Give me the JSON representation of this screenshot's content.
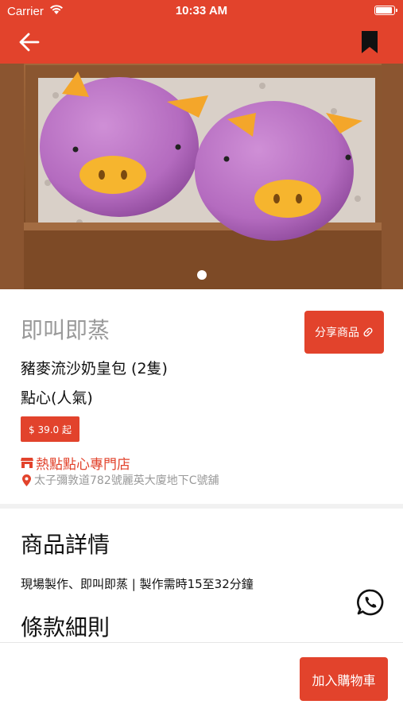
{
  "status_bar": {
    "carrier": "Carrier",
    "time": "10:33 AM",
    "battery_level": 0.9
  },
  "nav": {
    "back_icon": "arrow-left-icon",
    "bookmark_icon": "bookmark-icon"
  },
  "hero": {
    "image_page_index": 1,
    "image_page_count": 1
  },
  "product": {
    "shop_title": "即叫即蒸",
    "share_label": "分享商品",
    "share_icon": "link-icon",
    "name": "豬麥流沙奶皇包 (2隻)",
    "category": "點心(人氣)",
    "price_label": "$ 39.0 起",
    "store_name": "熱點點心專門店",
    "store_icon": "store-icon",
    "address": "太子彌敦道782號麗英大廈地下C號舖",
    "address_icon": "location-pin-icon"
  },
  "details": {
    "heading": "商品詳情",
    "text": "現場製作、即叫即蒸 | 製作需時15至32分鐘",
    "terms_heading": "條款細則",
    "whatsapp_icon": "whatsapp-icon"
  },
  "bottom": {
    "add_to_cart": "加入購物車"
  },
  "colors": {
    "brand": "#e2432c",
    "muted_text": "#9a9a9a",
    "text": "#111111"
  }
}
